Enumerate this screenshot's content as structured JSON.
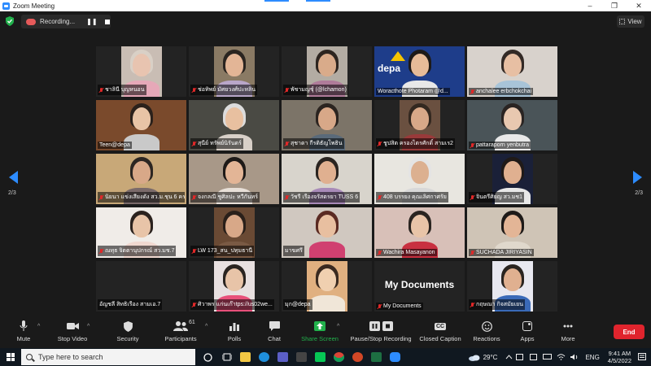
{
  "window": {
    "title": "Zoom Meeting",
    "min": "–",
    "max": "❐",
    "close": "✕"
  },
  "topbar": {
    "recording_label": "Recording...",
    "pause": "❚❚",
    "view_label": "View"
  },
  "paging": {
    "left": "2/3",
    "right": "2/3"
  },
  "tiles": [
    {
      "name": "ชาลินี บุญหนอน",
      "muted": true,
      "bg": "#c9bdb4",
      "skin": "#e8c4b0",
      "hair": "#d9d0c6",
      "shirt": "#e6a8b8"
    },
    {
      "name": "ช่อทิพย์ มัศยวงศ์ปะหลิน",
      "muted": true,
      "bg": "#8a7a64",
      "skin": "#e3b596",
      "hair": "#2a2420",
      "shirt": "#b9a6c9"
    },
    {
      "name": "พัชามญชุ์ (@lchamon)",
      "muted": true,
      "bg": "#b3aca3",
      "skin": "#d9ab8a",
      "hair": "#2d2520",
      "shirt": "#b07b9a"
    },
    {
      "name": "Woracthote Photaram @d...",
      "muted": false,
      "bg": "#1e3d8a",
      "skin": "#e6bb98",
      "hair": "#1d1a18",
      "shirt": "#e8e8e8"
    },
    {
      "name": "anchalee erbchokchai",
      "muted": true,
      "bg": "#d8d2cc",
      "skin": "#e7bfa3",
      "hair": "#332a26",
      "shirt": "#a8c4d8"
    },
    {
      "name": "Teen@depa",
      "muted": false,
      "bg": "#7a4a2c",
      "skin": "#e8c4a6",
      "hair": "#2b211b",
      "shirt": "#c9c9c9"
    },
    {
      "name": "สุนีย์ ทรัพย์นิรันดร์",
      "muted": true,
      "bg": "#4a4a44",
      "skin": "#e8c0a0",
      "hair": "#dcdcdc",
      "shirt": "#d8d0c8"
    },
    {
      "name": "สุชาดา กีรติธัญโพธิน",
      "muted": true,
      "bg": "#7c7468",
      "skin": "#d8a888",
      "hair": "#2b2420",
      "shirt": "#5a6a7a"
    },
    {
      "name": "ชูปสิต ครองไตรศักดิ์ สามเร2",
      "muted": true,
      "bg": "#6a5040",
      "skin": "#d8a888",
      "hair": "#332820",
      "shirt": "#9a3a3a"
    },
    {
      "name": "pattaraporn yenbutra",
      "muted": true,
      "bg": "#4a5458",
      "skin": "#e8c8b0",
      "hair": "#2a2422",
      "shirt": "#e8e8e8"
    },
    {
      "name": "นิยนา แข่งเสียงดัง สว.ม.ชุน 6 คร",
      "muted": true,
      "bg": "#c8a878",
      "skin": "#d8a888",
      "hair": "#2c2622",
      "shirt": "#7a6a6a"
    },
    {
      "name": "จงกลณี ชูศิลปะ หวีกันทร์",
      "muted": true,
      "bg": "#a89888",
      "skin": "#e3b596",
      "hair": "#1e1a18",
      "shirt": "#e8e0d8"
    },
    {
      "name": "วัชรี เรืองจรัสตรยา TUSS 6",
      "muted": true,
      "bg": "#d8d4cc",
      "skin": "#e0b090",
      "hair": "#2a2420",
      "shirt": "#a88ab8"
    },
    {
      "name": "408 บรรยง คุณเลิศกาศรัย",
      "muted": true,
      "bg": "#e8e6e0",
      "skin": "#dcb090",
      "hair": "#e4e4e4",
      "shirt": "#d8d8d8"
    },
    {
      "name": "จินตรีศิยญ สว.มช1",
      "muted": true,
      "bg": "#1a2038",
      "skin": "#e0b090",
      "hair": "#201a18",
      "shirt": "#e8e8e8"
    },
    {
      "name": "ณทุธ จิตตานุปกรณ์ สว.มช.7",
      "muted": true,
      "bg": "#f0ece8",
      "skin": "#e8c4a8",
      "hair": "#2b221e",
      "shirt": "#f0d8d0"
    },
    {
      "name": "LW 173_สน_ปทุมธานี",
      "muted": true,
      "bg": "#6a4a34",
      "skin": "#d8a888",
      "hair": "#2a201a",
      "shirt": "#7a5a44"
    },
    {
      "name": "มาฆศรี",
      "muted": false,
      "bg": "#d0c8c0",
      "skin": "#e8bfa0",
      "hair": "#5a2a22",
      "shirt": "#d04070"
    },
    {
      "name": "Wachira Masayanon",
      "muted": true,
      "bg": "#d8c0b8",
      "skin": "#e8c4a8",
      "hair": "#2a2420",
      "shirt": "#c83040"
    },
    {
      "name": "SUCHADA JIRIYASIN",
      "muted": true,
      "bg": "#cfc4b6",
      "skin": "#e3b596",
      "hair": "#1e1a18",
      "shirt": "#e0d8cc"
    },
    {
      "name": "อัญชลี สิทธิเรือง สามเอ.7",
      "muted": false,
      "bg": "#232323",
      "skin": "",
      "hair": "",
      "shirt": ""
    },
    {
      "name": "ศิวาพร แก่นเก๊าtps://us02we...",
      "muted": true,
      "bg": "#e8e0e0",
      "skin": "#e8c4a8",
      "hair": "#2a2420",
      "shirt": "#e8507a"
    },
    {
      "name": "มุก@depa",
      "muted": false,
      "bg": "#e0b080",
      "skin": "#f0d0b0",
      "hair": "#3a2a20",
      "shirt": "#f0e6d8"
    },
    {
      "name": "My Documents",
      "muted": true,
      "bg": "#232323",
      "skin": "",
      "hair": "",
      "shirt": ""
    },
    {
      "name": "กฤษณา กิจสมัยเยน",
      "muted": true,
      "bg": "#e8e8f0",
      "skin": "#e0b090",
      "hair": "#2a2420",
      "shirt": "#3a6ab8"
    }
  ],
  "big_names": {
    "tile23": "My Documents"
  },
  "depa_logo": "depa",
  "toolbar": {
    "mute": "Mute",
    "stop_video": "Stop Video",
    "security": "Security",
    "participants": "Participants",
    "participants_count": "61",
    "polls": "Polls",
    "chat": "Chat",
    "share_screen": "Share Screen",
    "pause_stop_recording": "Pause/Stop Recording",
    "closed_caption": "Closed Caption",
    "cc_glyph": "CC",
    "reactions": "Reactions",
    "apps": "Apps",
    "more": "More",
    "end": "End",
    "caret": "^"
  },
  "taskbar": {
    "search_placeholder": "Type here to search",
    "weather": "29°C",
    "lang": "ENG",
    "time": "9:41 AM",
    "date": "4/5/2022"
  },
  "colors": {
    "accent": "#2d8cff",
    "end": "#e0242d",
    "share": "#22b14c"
  }
}
